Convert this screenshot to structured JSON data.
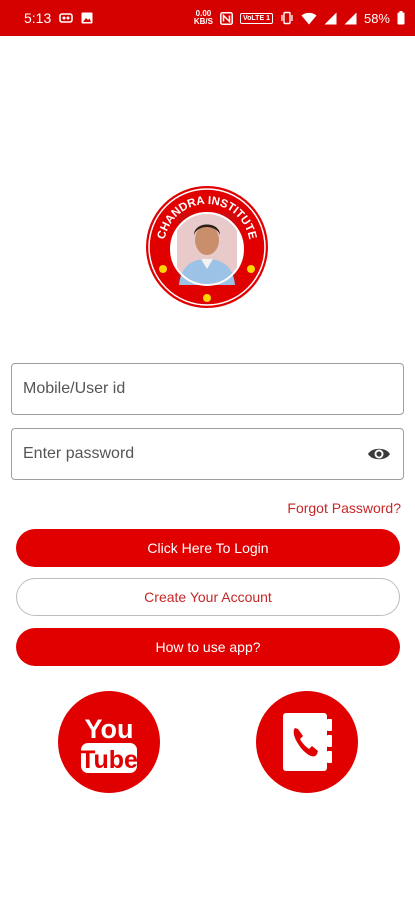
{
  "status_bar": {
    "time": "5:13",
    "speed_value": "0.00",
    "speed_unit": "KB/S",
    "volte": "VoLTE 1",
    "battery": "58%"
  },
  "logo": {
    "text": "CHANDRA INSTITUTE"
  },
  "login_form": {
    "mobile_placeholder": "Mobile/User id",
    "password_placeholder": "Enter password",
    "forgot_password": "Forgot Password?",
    "login_button": "Click Here To Login",
    "create_account_button": "Create Your Account",
    "how_to_use_button": "How to use app?"
  },
  "social": {
    "youtube_line1": "You",
    "youtube_line2": "Tube"
  },
  "colors": {
    "primary": "#e00000",
    "accent_text": "#c62828"
  }
}
